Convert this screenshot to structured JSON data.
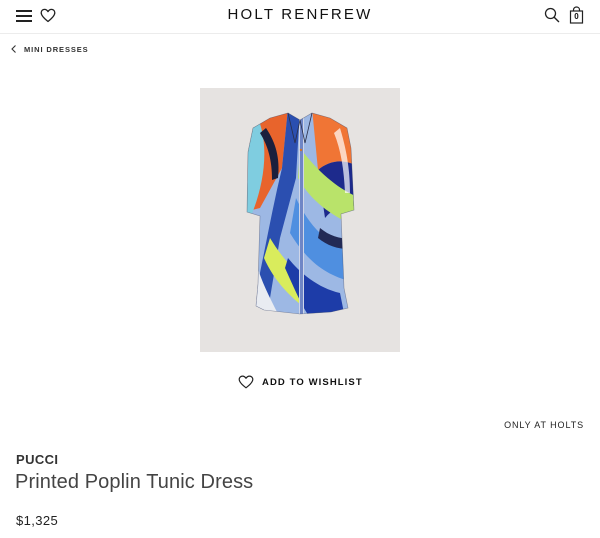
{
  "header": {
    "logo": "HOLT RENFREW",
    "bag_count": "0",
    "icons": [
      "menu-icon",
      "heart-icon",
      "search-icon",
      "shopping-bag-icon"
    ]
  },
  "breadcrumb": {
    "label": "MINI DRESSES",
    "icon": "chevron-left-icon"
  },
  "product": {
    "image_alt": "Printed Poplin Tunic Dress product photo",
    "wishlist_label": "ADD TO WISHLIST",
    "exclusive_label": "ONLY AT HOLTS",
    "brand": "PUCCI",
    "name": "Printed Poplin Tunic Dress",
    "price": "$1,325"
  }
}
